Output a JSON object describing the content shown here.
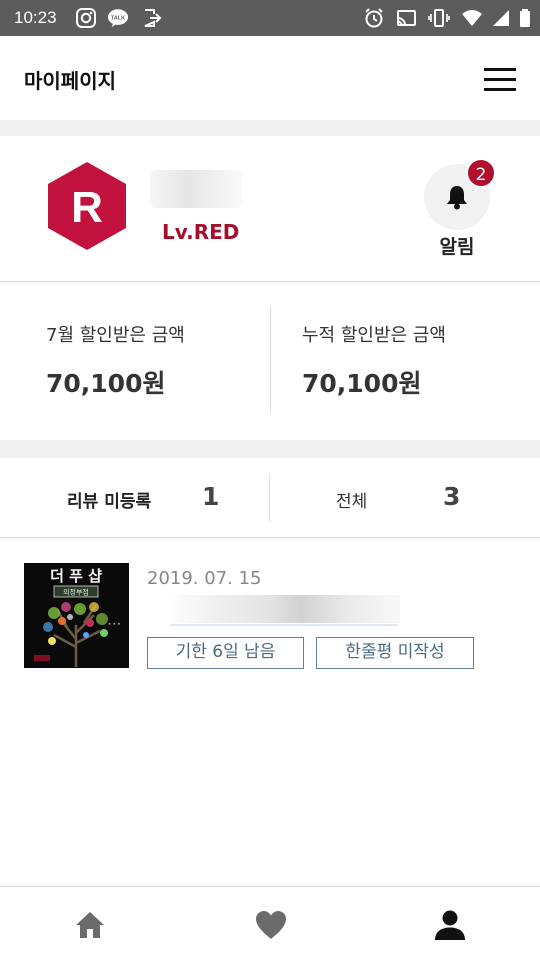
{
  "status_bar": {
    "time": "10:23",
    "icons": [
      "instagram-icon",
      "talk-icon",
      "exit-app-icon",
      "alarm-clock-icon",
      "cast-icon",
      "vibrate-icon",
      "wifi-icon",
      "signal-icon",
      "battery-icon"
    ],
    "talk_text": "TALK"
  },
  "header": {
    "title": "마이페이지",
    "menu_icon": "hamburger-menu-icon"
  },
  "profile": {
    "badge_letter": "R",
    "level": "Lv.RED",
    "alarm_count": "2",
    "alarm_label": "알림",
    "badge_color": "#c0123c",
    "level_color": "#a30f2d"
  },
  "discounts": {
    "month_label": "7월 할인받은 금액",
    "month_value": "70,100원",
    "total_label": "누적 할인받은 금액",
    "total_value": "70,100원"
  },
  "reviews": {
    "unregistered_label": "리뷰 미등록",
    "unregistered_count": "1",
    "all_label": "전체",
    "all_count": "3"
  },
  "order_item": {
    "date": "2019. 07. 15",
    "thumb_title": "더 푸 샵",
    "thumb_subtitle": "의정부점",
    "deadline_tag": "기한 6일 남음",
    "review_tag": "한줄평 미작성",
    "tag_color": "#4c6a84"
  },
  "bottom_nav": {
    "items": [
      "home-icon",
      "heart-icon",
      "person-icon"
    ]
  }
}
